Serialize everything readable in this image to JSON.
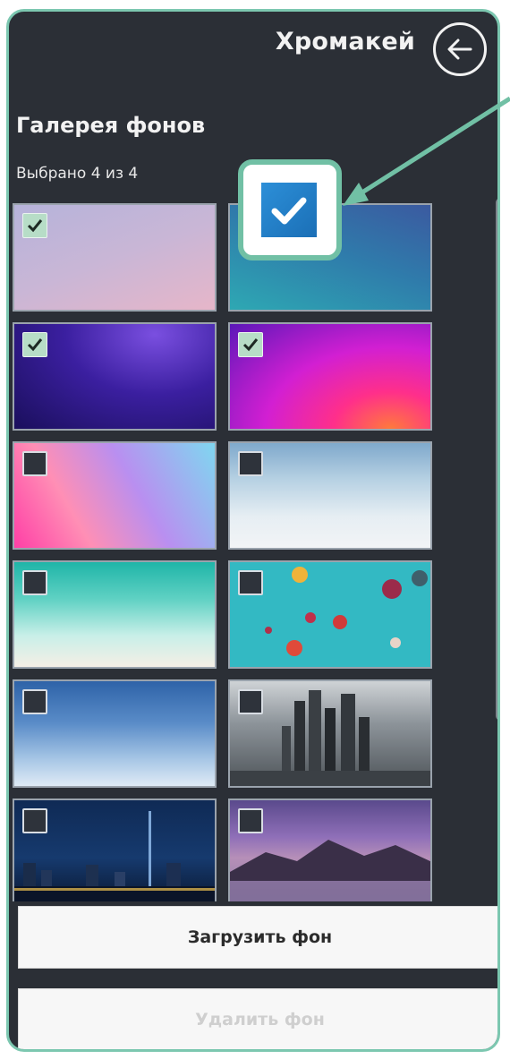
{
  "header": {
    "title": "Хромакей"
  },
  "gallery": {
    "title": "Галерея фонов",
    "selected_count": "Выбрано 4 из 4",
    "thumbnails": [
      {
        "name": "pastel-purple-pink-gradient",
        "checked": true
      },
      {
        "name": "teal-blue-gradient",
        "checked": true
      },
      {
        "name": "deep-purple-abstract",
        "checked": true
      },
      {
        "name": "magenta-orange-abstract",
        "checked": true
      },
      {
        "name": "pink-purple-cyan-gradient",
        "checked": false
      },
      {
        "name": "cloudy-sky",
        "checked": false
      },
      {
        "name": "turquoise-sea-beach",
        "checked": false
      },
      {
        "name": "hot-air-balloons",
        "checked": false
      },
      {
        "name": "blue-sky-clouds",
        "checked": false
      },
      {
        "name": "city-skyscrapers",
        "checked": false
      },
      {
        "name": "night-city-skyline",
        "checked": false
      },
      {
        "name": "mountain-lake-sunset",
        "checked": false
      }
    ]
  },
  "buttons": {
    "upload_label": "Загрузить фон",
    "delete_label": "Удалить фон"
  },
  "colors": {
    "panel_bg": "#2b2f36",
    "accent": "#71c0a5",
    "checkbox_checked": "#b7ddc7",
    "callout_checkbox": "#2c8fd8"
  }
}
